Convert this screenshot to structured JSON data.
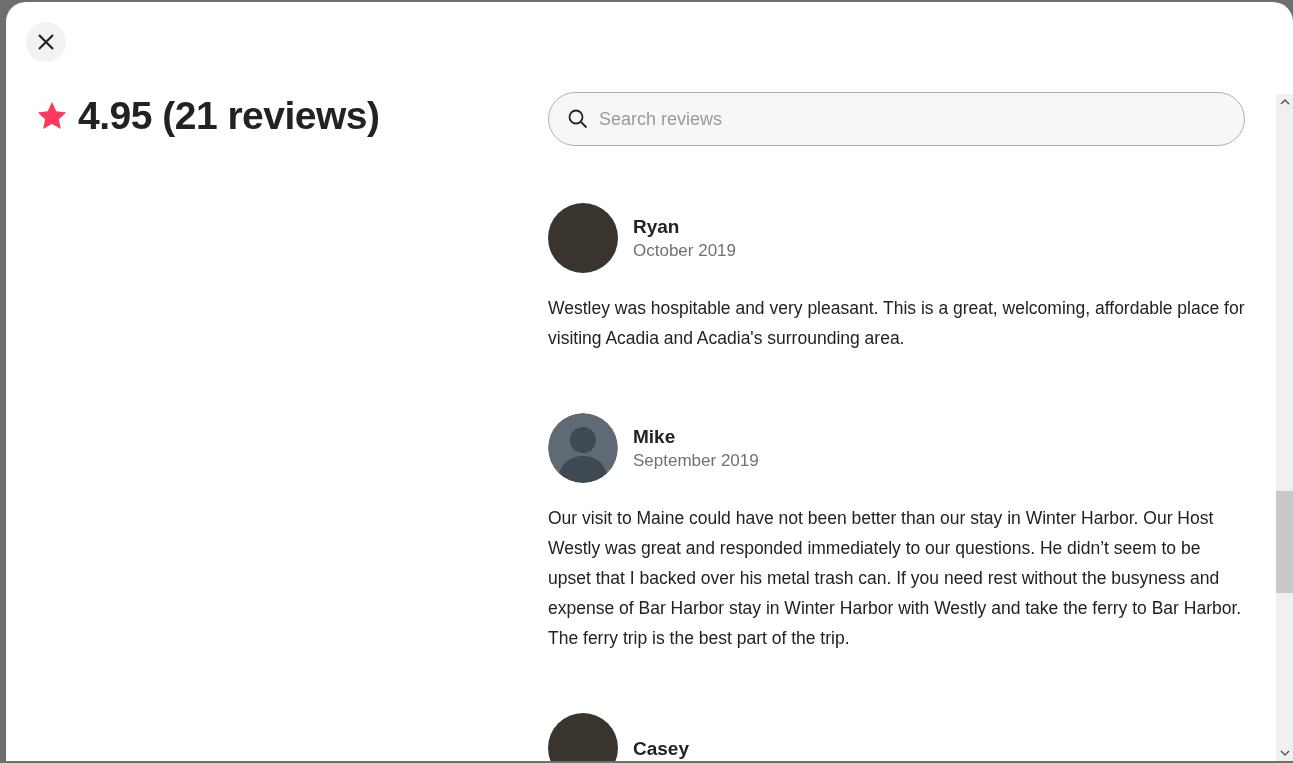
{
  "rating": {
    "text": "4.95 (21 reviews)"
  },
  "search": {
    "placeholder": "Search reviews"
  },
  "reviews": [
    {
      "name": "Ryan",
      "date": "October 2019",
      "kind": "photo",
      "text": "Westley was hospitable and very pleasant. This is a great, welcoming, affordable place for visiting Acadia and Acadia's surrounding area."
    },
    {
      "name": "Mike",
      "date": "September 2019",
      "kind": "default",
      "text": "Our visit to Maine could have not been better than our stay in Winter Harbor. Our Host Westly was great and responded immediately to our questions. He didn’t seem to be upset that I backed over his metal trash can. If you need rest without the busyness and expense of Bar Harbor stay in Winter Harbor with Westly and take the ferry to Bar Harbor. The ferry trip is the best part of the trip."
    },
    {
      "name": "Casey",
      "kind": "photo"
    }
  ]
}
